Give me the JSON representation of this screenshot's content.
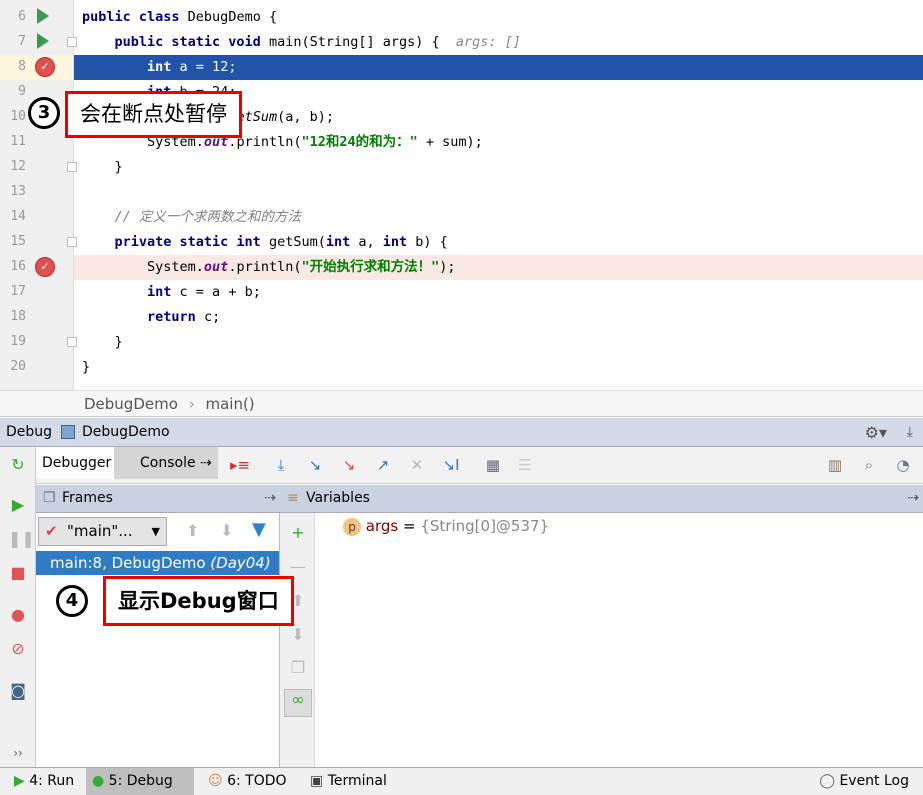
{
  "editor": {
    "lines": [
      {
        "n": "6",
        "html": "<span class='kw'>public class</span> DebugDemo {"
      },
      {
        "n": "7",
        "html": "    <span class='kw'>public static void</span> main(String[] args) {  <span class='hint'>args: []</span>"
      },
      {
        "n": "8",
        "html": "        <span class='kw'>int</span> a = 12;"
      },
      {
        "n": "9",
        "html": "        <span class='kw'>int</span> b = 24;"
      },
      {
        "n": "10",
        "html": "        <span class='kw'>int</span> sum = <i>getSum</i>(a, b);"
      },
      {
        "n": "11",
        "html": "        System.<span class='fld'>out</span>.println(<span class='str'>\"12和24的和为：\"</span> + sum);"
      },
      {
        "n": "12",
        "html": "    }"
      },
      {
        "n": "13",
        "html": ""
      },
      {
        "n": "14",
        "html": "    <span class='cmt'>// 定义一个求两数之和的方法</span>"
      },
      {
        "n": "15",
        "html": "    <span class='kw'>private static int</span> getSum(<span class='kw'>int</span> a, <span class='kw'>int</span> b) {"
      },
      {
        "n": "16",
        "html": "        System.<span class='fld'>out</span>.println(<span class='str'>\"开始执行求和方法！\"</span>);"
      },
      {
        "n": "17",
        "html": "        <span class='kw'>int</span> c = a + b;"
      },
      {
        "n": "18",
        "html": "        <span class='kw'>return</span> c;"
      },
      {
        "n": "19",
        "html": "    }"
      },
      {
        "n": "20",
        "html": "}"
      }
    ],
    "current_line": "8",
    "breakpoint_lines": [
      "8",
      "16"
    ],
    "colors": {
      "current": "#2154a8",
      "breakpoint": "#f9e8e4"
    }
  },
  "callouts": {
    "c3_num": "3",
    "c3_text": "会在断点处暂停",
    "c4_num": "4",
    "c4_text": "显示Debug窗口"
  },
  "breadcrumb": {
    "class": "DebugDemo",
    "sep": "›",
    "method": "main()"
  },
  "debug": {
    "title": "Debug",
    "config": "DebugDemo"
  },
  "tabs": {
    "debugger": "Debugger",
    "console": "Console"
  },
  "frames": {
    "title": "Frames",
    "thread": "\"main\"...",
    "frame": "main:8, DebugDemo",
    "frame_module": "(Day04)"
  },
  "variables": {
    "title": "Variables",
    "items": [
      {
        "badge": "p",
        "name": "args",
        "eq": "=",
        "value": "{String[0]@537}"
      }
    ]
  },
  "bottom": {
    "run": "4: Run",
    "debug": "5: Debug",
    "todo": "6: TODO",
    "terminal": "Terminal",
    "eventlog": "Event Log"
  }
}
